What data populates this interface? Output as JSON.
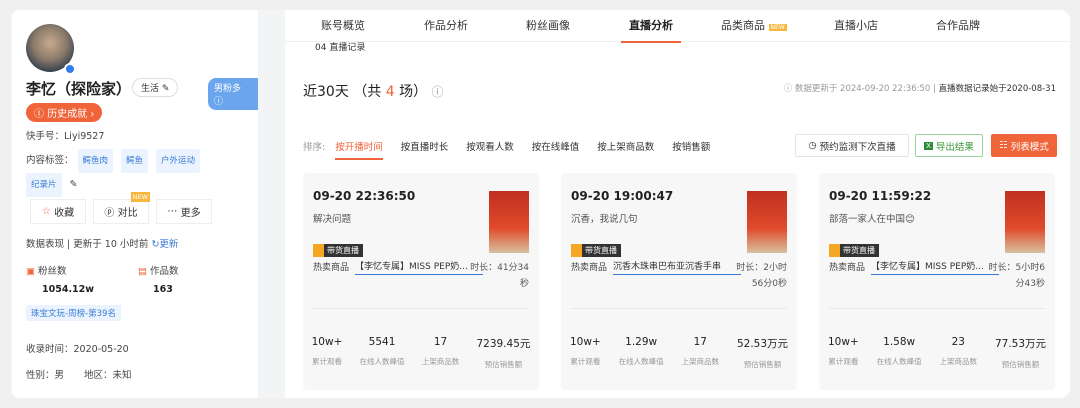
{
  "profile": {
    "name": "李忆（探险家）",
    "category": "生活",
    "fan_type": "男粉多",
    "history": "历史成就",
    "id_label": "快手号：",
    "id": "Liyi9527",
    "tags_label": "内容标签：",
    "tags": [
      "鳄鱼肉",
      "鳄鱼",
      "户外运动",
      "纪录片"
    ],
    "buttons": {
      "fav": "收藏",
      "compare": "对比",
      "compare_badge": "NEW",
      "more": "更多"
    },
    "data_perf": "数据表现",
    "updated": "更新于 10 小时前",
    "refresh": "更新",
    "fans_label": "粉丝数",
    "fans": "1054.12w",
    "works_label": "作品数",
    "works": "163",
    "rank": "珠宝文玩-周榜-第39名",
    "collected_label": "收录时间：",
    "collected": "2020-05-20",
    "gender_label": "性别：",
    "gender": "男",
    "region_label": "地区：",
    "region": "未知"
  },
  "nav": {
    "tabs": [
      "账号概览",
      "作品分析",
      "粉丝画像",
      "直播分析",
      "品类商品",
      "直播小店",
      "合作品牌"
    ],
    "new_badge": "NEW",
    "section": "04 直播记录"
  },
  "summary": {
    "prefix": "近30天 （共 ",
    "count": "4",
    "suffix": " 场）",
    "update_label": "数据更新于 2024-09-20 22:36:50",
    "record_since": "直播数据记录始于2020-08-31"
  },
  "sort": {
    "label": "排序:",
    "options": [
      "按开播时间",
      "按直播时长",
      "按观看人数",
      "按在线峰值",
      "按上架商品数",
      "按销售额"
    ]
  },
  "toolbar": {
    "schedule": "预约监测下次直播",
    "export": "导出结果",
    "list_mode": "列表模式"
  },
  "stat_labels": [
    "累计观看",
    "在线人数峰值",
    "上架商品数",
    "预估销售额"
  ],
  "live_badge": "带货直播",
  "hot_label": "热卖商品",
  "dur_label": "时长：",
  "cards": [
    {
      "time": "09-20 22:36:50",
      "title": "解决问题",
      "product": "【李忆专属】MISS PEP奶...",
      "duration": "41分34秒",
      "stats": [
        "10w+",
        "5541",
        "17",
        "7239.45元"
      ]
    },
    {
      "time": "09-20 19:00:47",
      "title": "沉香，我说几句",
      "product": "沉香木珠串巴布亚沉香手串",
      "duration": "2小时56分0秒",
      "stats": [
        "10w+",
        "1.29w",
        "17",
        "52.53万元"
      ]
    },
    {
      "time": "09-20 11:59:22",
      "title": "部落一家人在中国😊",
      "product": "【李忆专属】MISS PEP奶...",
      "duration": "5小时6分43秒",
      "stats": [
        "10w+",
        "1.58w",
        "23",
        "77.53万元"
      ]
    }
  ]
}
